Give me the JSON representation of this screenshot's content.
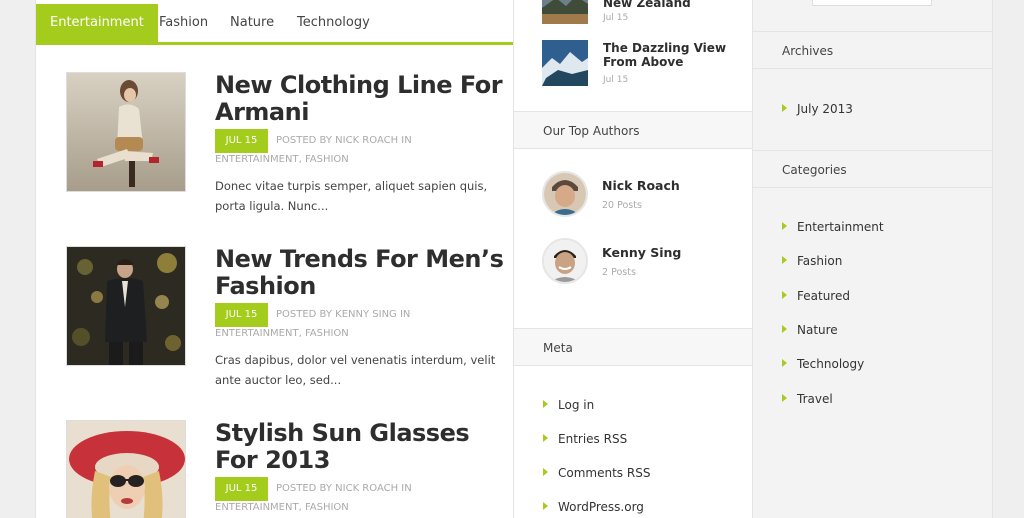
{
  "nav": {
    "tabs": [
      {
        "label": "Entertainment",
        "active": true
      },
      {
        "label": "Fashion"
      },
      {
        "label": "Nature"
      },
      {
        "label": "Technology"
      }
    ]
  },
  "posts": [
    {
      "title": "New Clothing Line For Armani",
      "date": "JUL 15",
      "byline": "POSTED BY NICK ROACH IN",
      "categories": "ENTERTAINMENT, FASHION",
      "excerpt": "Donec vitae turpis semper, aliquet sapien quis, porta ligula. Nunc..."
    },
    {
      "title": "New Trends For Men’s Fashion",
      "date": "JUL 15",
      "byline": "POSTED BY KENNY SING IN",
      "categories": "ENTERTAINMENT, FASHION",
      "excerpt": "Cras dapibus, dolor vel venenatis interdum, velit ante auctor leo, sed..."
    },
    {
      "title": "Stylish Sun Glasses For 2013",
      "date": "JUL 15",
      "byline": "POSTED BY NICK ROACH IN",
      "categories": "ENTERTAINMENT, FASHION",
      "excerpt": ""
    }
  ],
  "thumb_posts": [
    {
      "title": "New Zealand",
      "date": "Jul 15"
    },
    {
      "title": "The Dazzling View From Above",
      "date": "Jul 15"
    }
  ],
  "top_authors": {
    "heading": "Our Top Authors",
    "authors": [
      {
        "name": "Nick Roach",
        "posts": "20 Posts"
      },
      {
        "name": "Kenny Sing",
        "posts": "2 Posts"
      }
    ]
  },
  "meta": {
    "heading": "Meta",
    "links": [
      "Log in",
      "Entries RSS",
      "Comments RSS",
      "WordPress.org"
    ]
  },
  "archives": {
    "heading": "Archives",
    "items": [
      "July 2013"
    ]
  },
  "categories": {
    "heading": "Categories",
    "items": [
      "Entertainment",
      "Fashion",
      "Featured",
      "Nature",
      "Technology",
      "Travel"
    ]
  },
  "colors": {
    "accent": "#a4cc1d",
    "title_text": "#2e2e2e",
    "meta_text": "#aaaaaa"
  }
}
